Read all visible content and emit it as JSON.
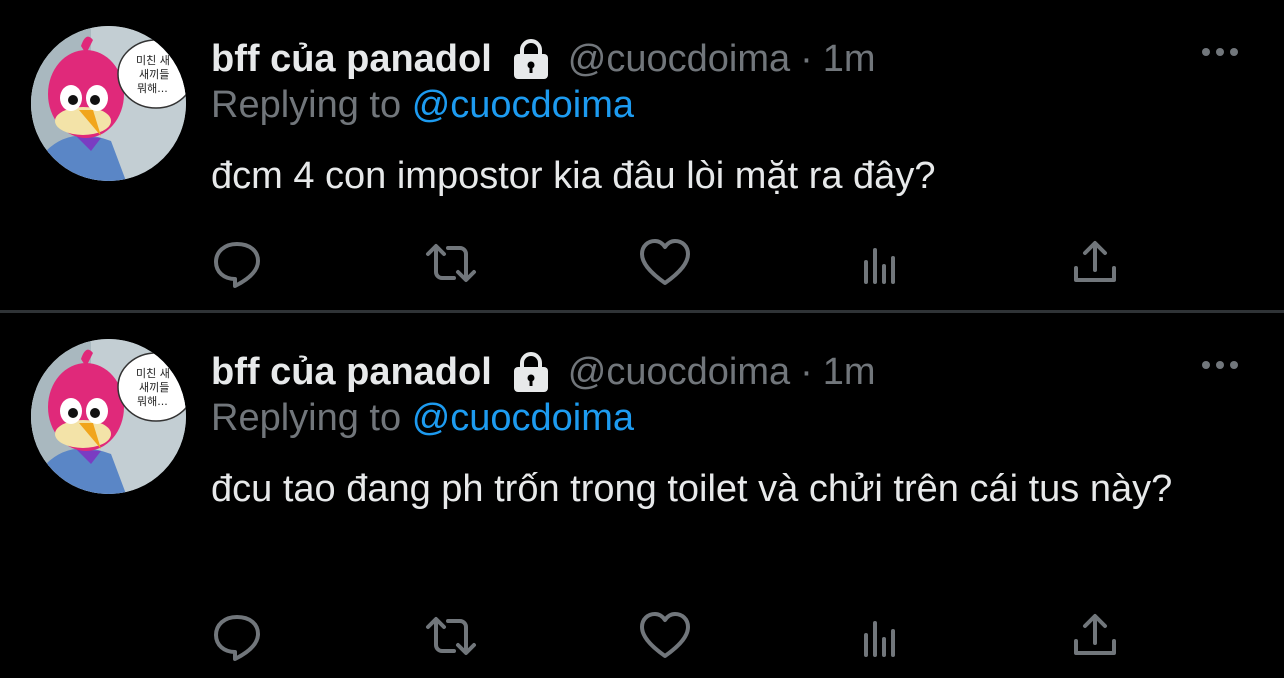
{
  "tweets": [
    {
      "display_name": "bff của panadol",
      "handle": "@cuocdoima",
      "separator": "·",
      "time": "1m",
      "replying_prefix": "Replying to",
      "replying_to": "@cuocdoima",
      "text": "đcm 4 con impostor kia đâu lòi mặt ra đây?",
      "avatar_speech": [
        "미친 새",
        "새끼들",
        "뭐해..."
      ]
    },
    {
      "display_name": "bff của panadol",
      "handle": "@cuocdoima",
      "separator": "·",
      "time": "1m",
      "replying_prefix": "Replying to",
      "replying_to": "@cuocdoima",
      "text": "đcu tao đang ph trốn trong toilet và chửi trên cái tus này?",
      "avatar_speech": [
        "미친 새",
        "새끼들",
        "뭐해..."
      ]
    }
  ],
  "icons": {
    "lock": "lock-icon",
    "more": "more-icon",
    "reply": "reply-icon",
    "retweet": "retweet-icon",
    "like": "heart-icon",
    "views": "views-icon",
    "share": "share-icon"
  },
  "colors": {
    "background": "#000000",
    "text": "#e7e9ea",
    "muted": "#71767b",
    "link": "#1d9bf0",
    "divider": "#2f3336"
  }
}
